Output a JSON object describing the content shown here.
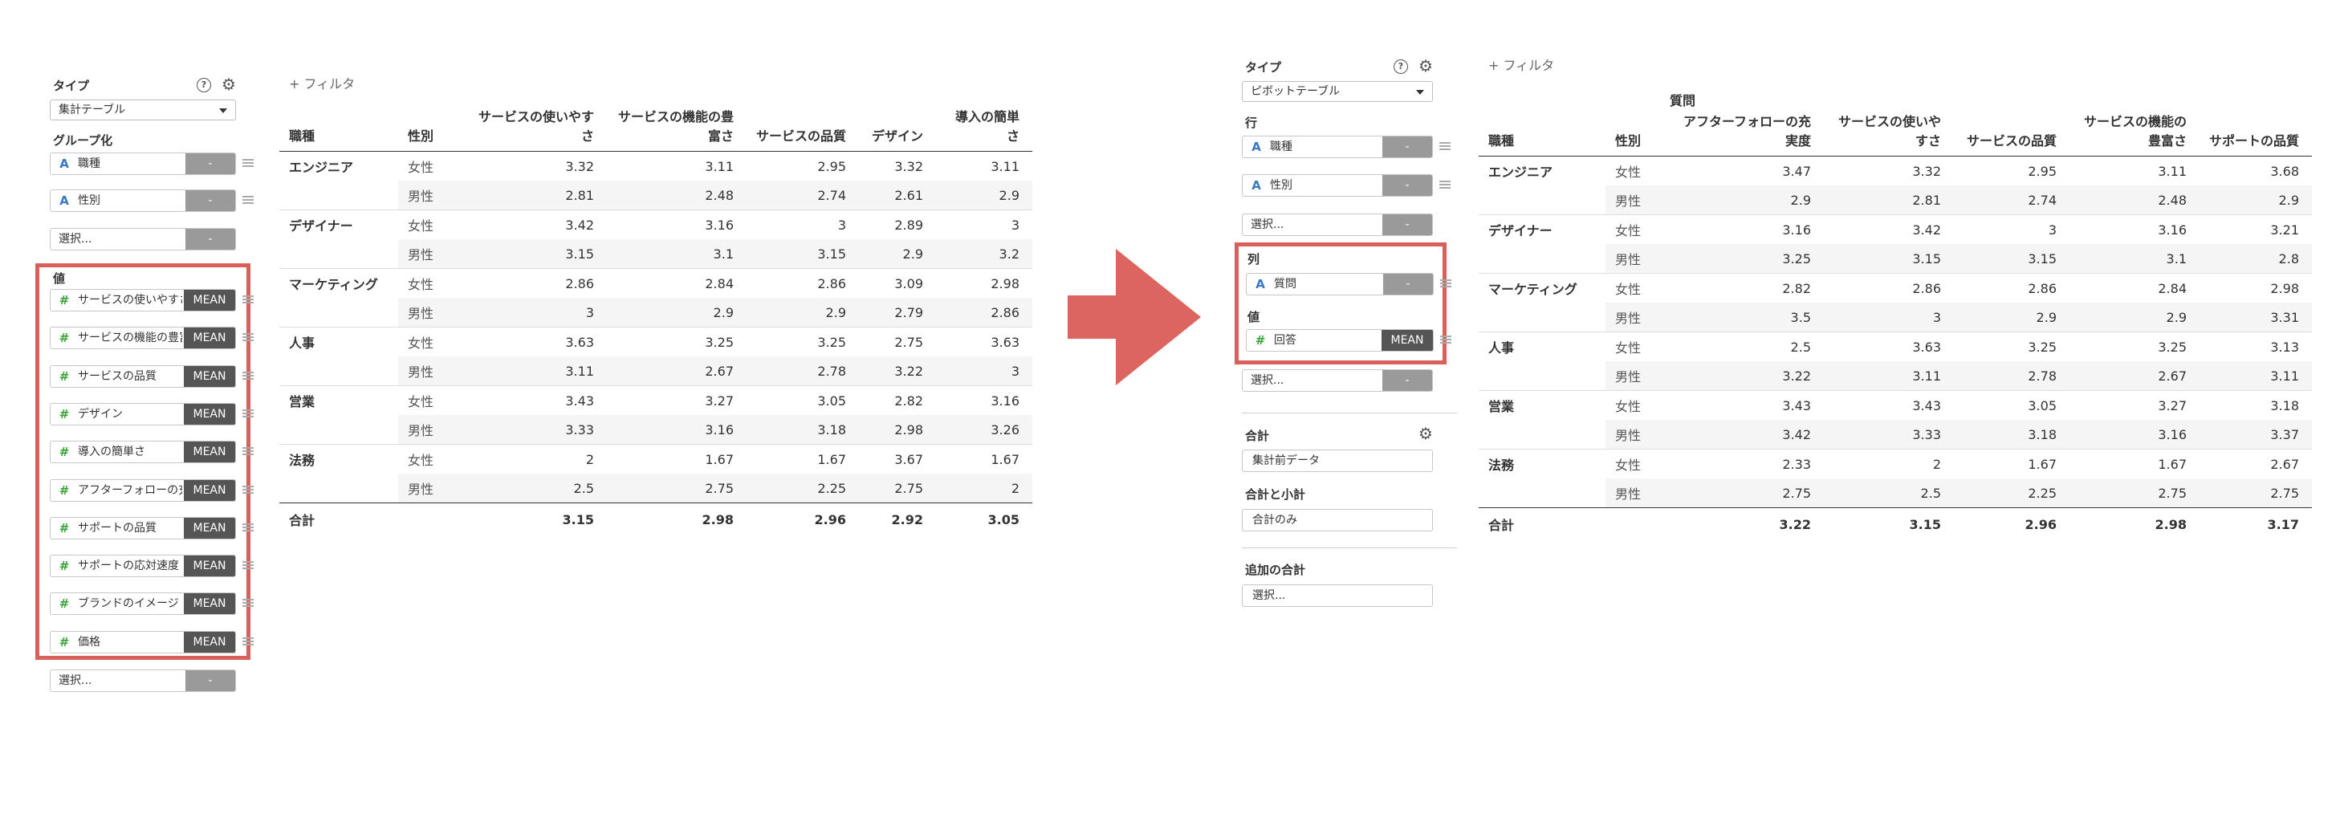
{
  "left_panel": {
    "type_label": "タイプ",
    "type_value": "集計テーブル",
    "group_label": "グループ化",
    "group_fields": [
      {
        "icon": "A",
        "name": "職種",
        "btn": "-"
      },
      {
        "icon": "A",
        "name": "性別",
        "btn": "-"
      }
    ],
    "group_select": {
      "placeholder": "選択...",
      "btn": "-"
    },
    "value_label": "値",
    "value_fields": [
      {
        "icon": "#",
        "name": "サービスの使いやすさ",
        "btn": "MEAN"
      },
      {
        "icon": "#",
        "name": "サービスの機能の豊富さ",
        "btn": "MEAN"
      },
      {
        "icon": "#",
        "name": "サービスの品質",
        "btn": "MEAN"
      },
      {
        "icon": "#",
        "name": "デザイン",
        "btn": "MEAN"
      },
      {
        "icon": "#",
        "name": "導入の簡単さ",
        "btn": "MEAN"
      },
      {
        "icon": "#",
        "name": "アフターフォローの充実度",
        "btn": "MEAN"
      },
      {
        "icon": "#",
        "name": "サポートの品質",
        "btn": "MEAN"
      },
      {
        "icon": "#",
        "name": "サポートの応対速度",
        "btn": "MEAN"
      },
      {
        "icon": "#",
        "name": "ブランドのイメージ",
        "btn": "MEAN"
      },
      {
        "icon": "#",
        "name": "価格",
        "btn": "MEAN"
      }
    ],
    "value_select": {
      "placeholder": "選択...",
      "btn": "-"
    }
  },
  "left_filter": "+ フィルタ",
  "left_table": {
    "headers": [
      "職種",
      "性別",
      "サービスの使いやすさ",
      "サービスの機能の豊富さ",
      "サービスの品質",
      "デザイン",
      "導入の簡単さ"
    ],
    "groups": [
      {
        "role": "エンジニア",
        "rows": [
          {
            "sex": "女性",
            "values": [
              "3.32",
              "3.11",
              "2.95",
              "3.32",
              "3.11"
            ]
          },
          {
            "sex": "男性",
            "values": [
              "2.81",
              "2.48",
              "2.74",
              "2.61",
              "2.9"
            ]
          }
        ]
      },
      {
        "role": "デザイナー",
        "rows": [
          {
            "sex": "女性",
            "values": [
              "3.42",
              "3.16",
              "3",
              "2.89",
              "3"
            ]
          },
          {
            "sex": "男性",
            "values": [
              "3.15",
              "3.1",
              "3.15",
              "2.9",
              "3.2"
            ]
          }
        ]
      },
      {
        "role": "マーケティング",
        "rows": [
          {
            "sex": "女性",
            "values": [
              "2.86",
              "2.84",
              "2.86",
              "3.09",
              "2.98"
            ]
          },
          {
            "sex": "男性",
            "values": [
              "3",
              "2.9",
              "2.9",
              "2.79",
              "2.86"
            ]
          }
        ]
      },
      {
        "role": "人事",
        "rows": [
          {
            "sex": "女性",
            "values": [
              "3.63",
              "3.25",
              "3.25",
              "2.75",
              "3.63"
            ]
          },
          {
            "sex": "男性",
            "values": [
              "3.11",
              "2.67",
              "2.78",
              "3.22",
              "3"
            ]
          }
        ]
      },
      {
        "role": "営業",
        "rows": [
          {
            "sex": "女性",
            "values": [
              "3.43",
              "3.27",
              "3.05",
              "2.82",
              "3.16"
            ]
          },
          {
            "sex": "男性",
            "values": [
              "3.33",
              "3.16",
              "3.18",
              "2.98",
              "3.26"
            ]
          }
        ]
      },
      {
        "role": "法務",
        "rows": [
          {
            "sex": "女性",
            "values": [
              "2",
              "1.67",
              "1.67",
              "3.67",
              "1.67"
            ]
          },
          {
            "sex": "男性",
            "values": [
              "2.5",
              "2.75",
              "2.25",
              "2.75",
              "2"
            ]
          }
        ]
      }
    ],
    "total": {
      "label": "合計",
      "values": [
        "3.15",
        "2.98",
        "2.96",
        "2.92",
        "3.05"
      ]
    }
  },
  "right_panel": {
    "type_label": "タイプ",
    "type_value": "ピボットテーブル",
    "row_label": "行",
    "row_fields": [
      {
        "icon": "A",
        "name": "職種",
        "btn": "-"
      },
      {
        "icon": "A",
        "name": "性別",
        "btn": "-"
      }
    ],
    "row_select": {
      "placeholder": "選択...",
      "btn": "-"
    },
    "col_label": "列",
    "col_field": {
      "icon": "A",
      "name": "質問",
      "btn": "-"
    },
    "value_label": "値",
    "value_field": {
      "icon": "#",
      "name": "回答",
      "btn": "MEAN"
    },
    "value_select": {
      "placeholder": "選択...",
      "btn": "-"
    },
    "sum_label": "合計",
    "sum_value": "集計前データ",
    "subtotal_label": "合計と小計",
    "subtotal_value": "合計のみ",
    "extra_label": "追加の合計",
    "extra_value": "選択..."
  },
  "right_filter": "+ フィルタ",
  "right_table": {
    "superheader": "質問",
    "headers": [
      "職種",
      "性別",
      "アフターフォローの充実度",
      "サービスの使いやすさ",
      "サービスの品質",
      "サービスの機能の豊富さ",
      "サポートの品質"
    ],
    "groups": [
      {
        "role": "エンジニア",
        "rows": [
          {
            "sex": "女性",
            "values": [
              "3.47",
              "3.32",
              "2.95",
              "3.11",
              "3.68"
            ]
          },
          {
            "sex": "男性",
            "values": [
              "2.9",
              "2.81",
              "2.74",
              "2.48",
              "2.9"
            ]
          }
        ]
      },
      {
        "role": "デザイナー",
        "rows": [
          {
            "sex": "女性",
            "values": [
              "3.16",
              "3.42",
              "3",
              "3.16",
              "3.21"
            ]
          },
          {
            "sex": "男性",
            "values": [
              "3.25",
              "3.15",
              "3.15",
              "3.1",
              "2.8"
            ]
          }
        ]
      },
      {
        "role": "マーケティング",
        "rows": [
          {
            "sex": "女性",
            "values": [
              "2.82",
              "2.86",
              "2.86",
              "2.84",
              "2.98"
            ]
          },
          {
            "sex": "男性",
            "values": [
              "3.5",
              "3",
              "2.9",
              "2.9",
              "3.31"
            ]
          }
        ]
      },
      {
        "role": "人事",
        "rows": [
          {
            "sex": "女性",
            "values": [
              "2.5",
              "3.63",
              "3.25",
              "3.25",
              "3.13"
            ]
          },
          {
            "sex": "男性",
            "values": [
              "3.22",
              "3.11",
              "2.78",
              "2.67",
              "3.11"
            ]
          }
        ]
      },
      {
        "role": "営業",
        "rows": [
          {
            "sex": "女性",
            "values": [
              "3.43",
              "3.43",
              "3.05",
              "3.27",
              "3.18"
            ]
          },
          {
            "sex": "男性",
            "values": [
              "3.42",
              "3.33",
              "3.18",
              "3.16",
              "3.37"
            ]
          }
        ]
      },
      {
        "role": "法務",
        "rows": [
          {
            "sex": "女性",
            "values": [
              "2.33",
              "2",
              "1.67",
              "1.67",
              "2.67"
            ]
          },
          {
            "sex": "男性",
            "values": [
              "2.75",
              "2.5",
              "2.25",
              "2.75",
              "2.75"
            ]
          }
        ]
      }
    ],
    "total": {
      "label": "合計",
      "values": [
        "3.22",
        "3.15",
        "2.96",
        "2.98",
        "3.17"
      ]
    }
  },
  "colors": {
    "highlight": "#d9605a",
    "arrow": "#dd6560",
    "mean_button": "#555555",
    "dash_button": "#9a9a9a"
  }
}
